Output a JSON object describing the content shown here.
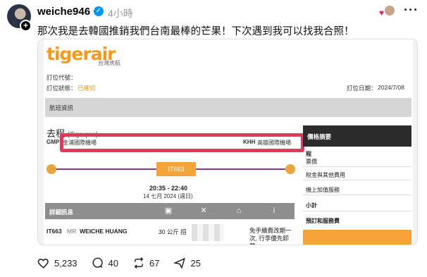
{
  "post": {
    "username": "weiche946",
    "time": "4小時",
    "text": "那次我是去韓國推銷我們台南最棒的芒果！下次遇到我可以找我合照！"
  },
  "ticket": {
    "logo": "tigerair",
    "logo_sub": "台灣虎航",
    "booking_code_label": "訂位代號：",
    "booking_status_label": "訂位狀態：",
    "booking_status_value": "已確認",
    "booking_date_label": "訂位日期：",
    "booking_date_value": "2024/7/08",
    "flight_info_label": "航班資訊",
    "departure_label": "去程",
    "departure_sub": "(Tigerpro)",
    "origin_code": "GMP",
    "origin_name": "金浦國際機場",
    "dest_code": "KHH",
    "dest_name": "高雄國際機場",
    "flight_no": "IT663",
    "times": "20:35 - 22:40",
    "date": "14 七月 2024 (週日)",
    "details_label": "詳細訊息",
    "pax_flight": "IT663",
    "pax_title": "MR",
    "pax_name": "WEICHE HUANG",
    "pax_bag": "30 公斤 招",
    "pax_note_1": "免手續費改期一",
    "pax_note_2": "次, 行李優先卸",
    "pax_note_3": "載",
    "price_summary": "價格摘要",
    "side_items": [
      "程",
      "票價",
      "稅金與其他費用",
      "機上加值服務",
      "小計",
      "預訂和服務費"
    ]
  },
  "actions": {
    "likes": "5,233",
    "comments": "40",
    "reposts": "67",
    "shares": "25"
  },
  "colors": {
    "accent_orange": "#f5a43a",
    "highlight_red": "#e8365a",
    "verified_blue": "#0095f6"
  }
}
